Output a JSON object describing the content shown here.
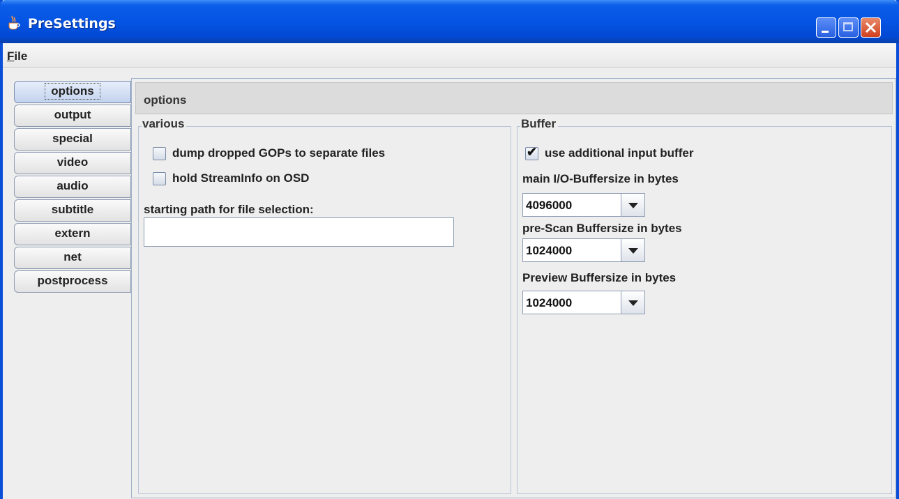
{
  "window": {
    "title": "PreSettings"
  },
  "menubar": {
    "file": "File"
  },
  "tabs": [
    {
      "label": "options",
      "active": true
    },
    {
      "label": "output"
    },
    {
      "label": "special"
    },
    {
      "label": "video"
    },
    {
      "label": "audio"
    },
    {
      "label": "subtitle"
    },
    {
      "label": "extern"
    },
    {
      "label": "net"
    },
    {
      "label": "postprocess"
    }
  ],
  "header": {
    "title": "options"
  },
  "various": {
    "title": "various",
    "dump_gops": {
      "label": "dump dropped GOPs to separate files",
      "checked": false
    },
    "hold_streaminfo": {
      "label": "hold StreamInfo on OSD",
      "checked": false
    },
    "path_label": "starting path for file selection:",
    "path_value": ""
  },
  "buffer": {
    "title": "Buffer",
    "use_additional": {
      "label": "use additional input buffer",
      "checked": true
    },
    "main_label": "main I/O-Buffersize in bytes",
    "main_value": "4096000",
    "prescan_label": "pre-Scan Buffersize in bytes",
    "prescan_value": "1024000",
    "preview_label": "Preview Buffersize in bytes",
    "preview_value": "1024000"
  }
}
